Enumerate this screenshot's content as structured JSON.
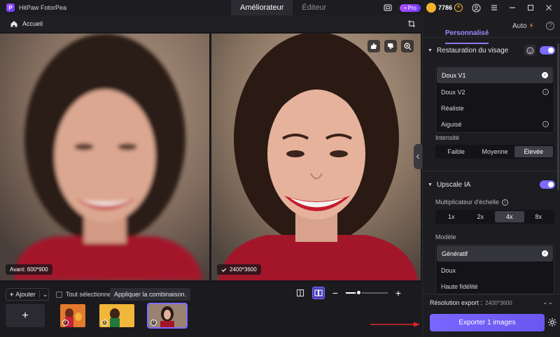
{
  "app": {
    "title": "HitPaw FotorPea",
    "logo_letter": "P"
  },
  "modes": [
    {
      "label": "Améliorateur",
      "active": true
    },
    {
      "label": "Éditeur",
      "active": false
    }
  ],
  "titlebar": {
    "pro_label": "• Pro",
    "coins": "7786",
    "coin_add": "+"
  },
  "breadcrumb": {
    "label": "Accueil"
  },
  "panels": {
    "before_label": "Avant: 600*900",
    "after_label": "2400*3600"
  },
  "bottombar": {
    "add_label": "Ajouter",
    "add_plus": "+",
    "add_chevron": "⌄",
    "select_all_label": "Tout sélectionner",
    "apply_label": "Appliquer la combinaison.",
    "zoom_minus": "−",
    "zoom_plus": "+",
    "zoom_level": 0.3,
    "thumb_add": "+"
  },
  "sidebar": {
    "tabs": [
      {
        "label": "Personnalisé",
        "active": true
      },
      {
        "label": "Auto",
        "active": false
      }
    ],
    "auto_icon": "⚡",
    "help": "?",
    "face": {
      "title": "Restauration du visage",
      "enabled": true,
      "models": [
        {
          "label": "Doux V1",
          "selected": true,
          "icon": "check"
        },
        {
          "label": "Doux V2",
          "selected": false,
          "icon": "download"
        },
        {
          "label": "Réaliste",
          "selected": false,
          "icon": ""
        },
        {
          "label": "Aiguisé",
          "selected": false,
          "icon": "download"
        }
      ],
      "intensity_label": "Intensité",
      "intensity_options": [
        "Faible",
        "Moyenne",
        "Élevée"
      ],
      "intensity_selected": 2
    },
    "upscale": {
      "title": "Upscale IA",
      "enabled": true,
      "scale_label": "Multiplicateur d'échelle",
      "scale_info": "i",
      "scale_options": [
        "1x",
        "2x",
        "4x",
        "8x"
      ],
      "scale_selected": 2,
      "model_label": "Modèle",
      "models": [
        {
          "label": "Génératif",
          "selected": true,
          "icon": "check"
        },
        {
          "label": "Doux",
          "selected": false,
          "icon": ""
        },
        {
          "label": "Haute fidélité",
          "selected": false,
          "icon": ""
        }
      ]
    },
    "export_res_label": "Résolution export :",
    "export_res_value": "2400*3600",
    "export_button": "Exporter 1 images"
  },
  "colors": {
    "accent": "#7b6cff",
    "annotation_arrow": "#e0262a"
  }
}
